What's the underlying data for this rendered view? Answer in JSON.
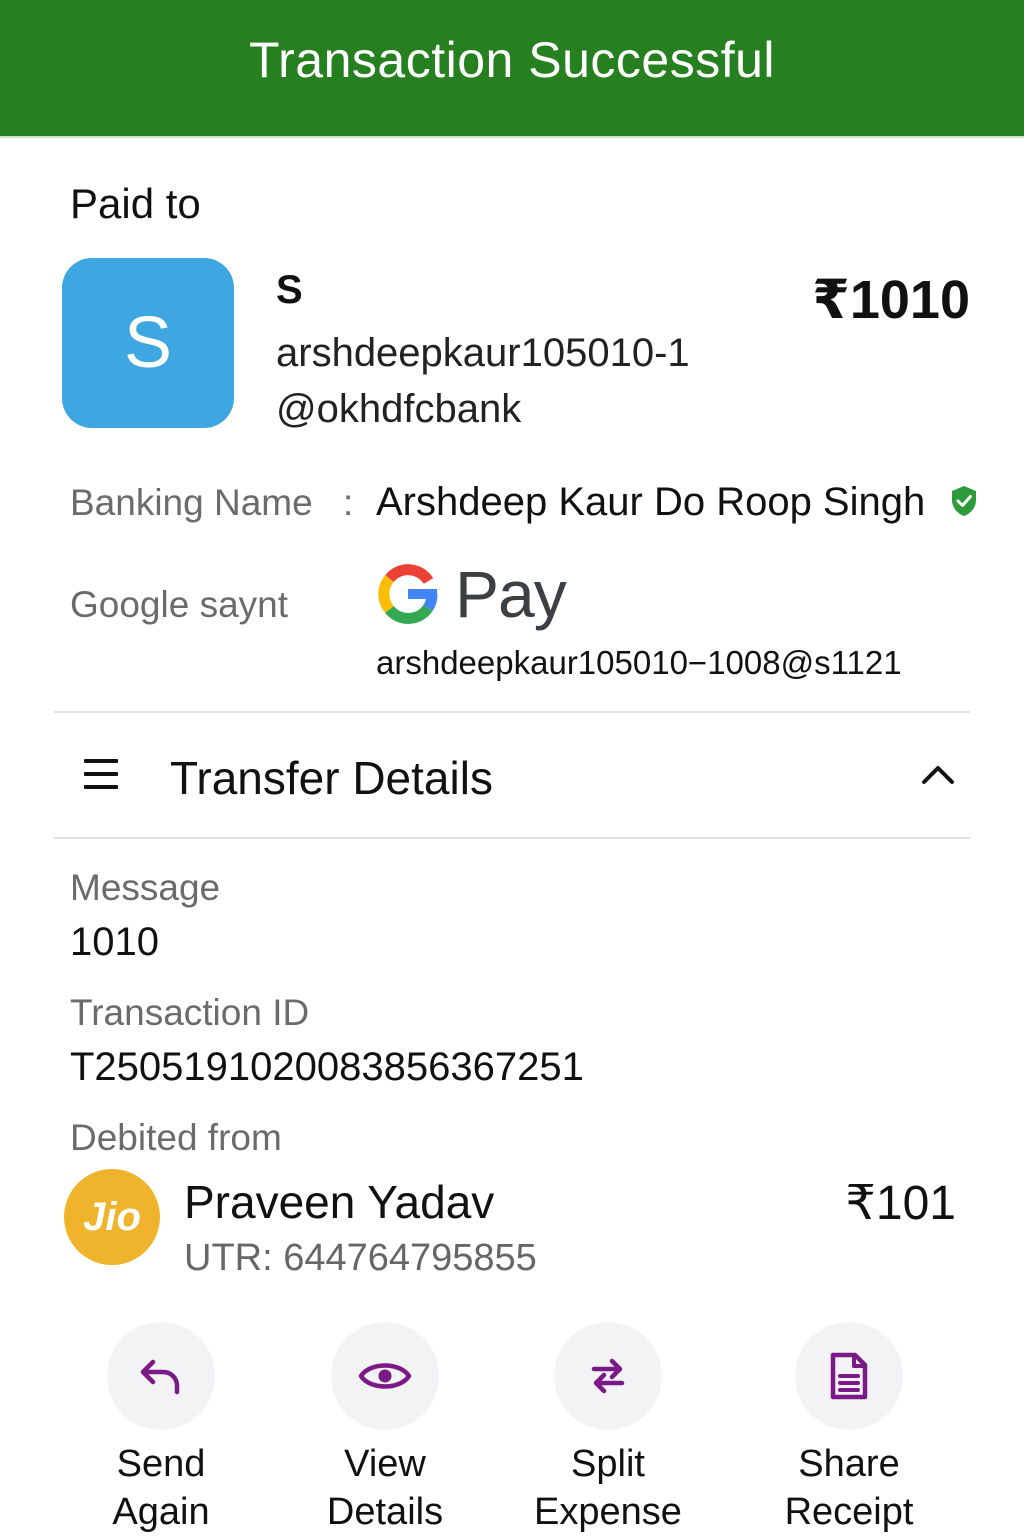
{
  "header": {
    "title": "Transaction Successful"
  },
  "paid_to": {
    "label": "Paid to",
    "avatar_letter": "S",
    "name": "S",
    "upi_id": "arshdeepkaur105010-1@okhdfcbank",
    "amount": "₹1010"
  },
  "banking_name": {
    "label": "Banking Name",
    "separator": ":",
    "value": "Arshdeep Kaur Do Roop Singh",
    "verified_icon": "verified-shield-icon"
  },
  "google_pay": {
    "label": "Google saynt",
    "brand_text": "Pay",
    "upi_id": "arshdeepkaur105010−1008@s1121"
  },
  "transfer_details": {
    "title": "Transfer Details",
    "message_label": "Message",
    "message_value": "1010",
    "txn_label": "Transaction ID",
    "txn_value": "T2505191020083856367251",
    "debited_label": "Debited from",
    "bank_logo_text": "Jio",
    "account_name": "Praveen Yadav",
    "utr": "UTR: 644764795855",
    "debit_amount": "₹101"
  },
  "actions": [
    {
      "label": "Send\nAgain",
      "icon": "reply-arrow-icon"
    },
    {
      "label": "View\nDetails",
      "icon": "eye-icon"
    },
    {
      "label": "Split\nExpense",
      "icon": "swap-arrows-icon"
    },
    {
      "label": "Share\nReceipt",
      "icon": "document-icon"
    }
  ],
  "colors": {
    "header_bg": "#27801f",
    "avatar_bg": "#3ea6e0",
    "accent_purple": "#7a1a86",
    "jio_bg": "#f0b42c",
    "verified_green": "#2e9b3a"
  }
}
